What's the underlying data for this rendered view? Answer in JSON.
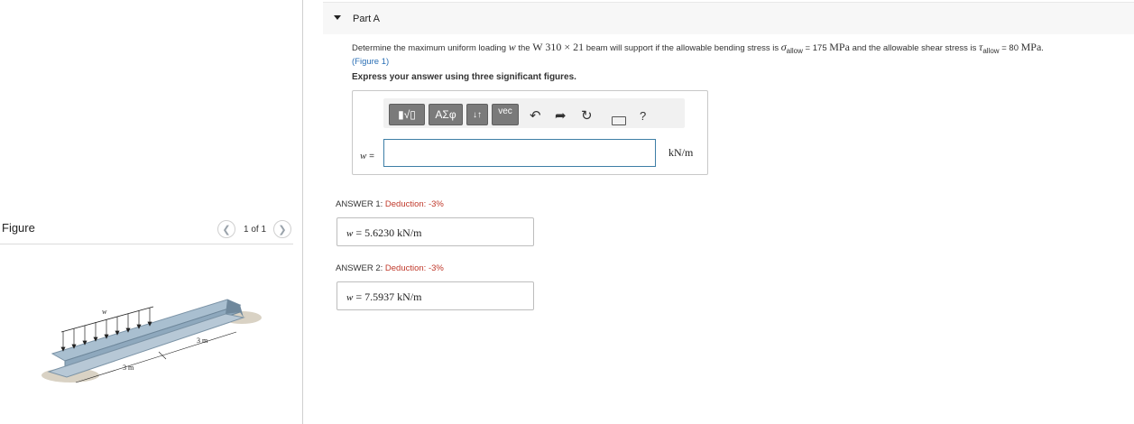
{
  "figure_panel": {
    "title": "Figure",
    "pager_text": "1 of 1",
    "labels": {
      "load": "w",
      "span1": "3 m",
      "span2": "3 m"
    }
  },
  "part": {
    "title": "Part A"
  },
  "question": {
    "intro": "Determine the maximum uniform loading",
    "variable": "w",
    "the": "the",
    "beam_shape": "W 310 × 21",
    "beam_text": "beam will support if the allowable bending stress is",
    "sigma": "σ",
    "sigma_sub": "allow",
    "sigma_eq": "=",
    "sigma_value": "175",
    "sigma_unit": "MPa",
    "and_text": "and the allowable shear stress is",
    "tau": "τ",
    "tau_sub": "allow",
    "tau_eq": "=",
    "tau_value": "80",
    "tau_unit": "MPa",
    "end": ".",
    "figure_link": "(Figure 1)"
  },
  "instruction": "Express your answer using three significant figures.",
  "toolbar": {
    "templates_label": "▮√▯",
    "greek_label": "ΑΣφ",
    "arrows_label": "↓↑",
    "vec_label": "vec",
    "help_label": "?",
    "icons": [
      "templates-icon",
      "undo-icon",
      "redo-icon",
      "reset-icon",
      "keyboard-icon",
      "help-icon"
    ]
  },
  "input": {
    "var_label": "w",
    "eq": "=",
    "value": "",
    "unit": "kN/m"
  },
  "answers": [
    {
      "label": "ANSWER 1:",
      "deduction": "Deduction: -3%",
      "var": "w",
      "eq": "=",
      "value": "5.6230",
      "unit": "kN/m"
    },
    {
      "label": "ANSWER 2:",
      "deduction": "Deduction: -3%",
      "var": "w",
      "eq": "=",
      "value": "7.5937",
      "unit": "kN/m"
    }
  ],
  "colors": {
    "accent": "#3d7ea6",
    "deduction": "#c0392b",
    "link": "#2a6fb5"
  }
}
